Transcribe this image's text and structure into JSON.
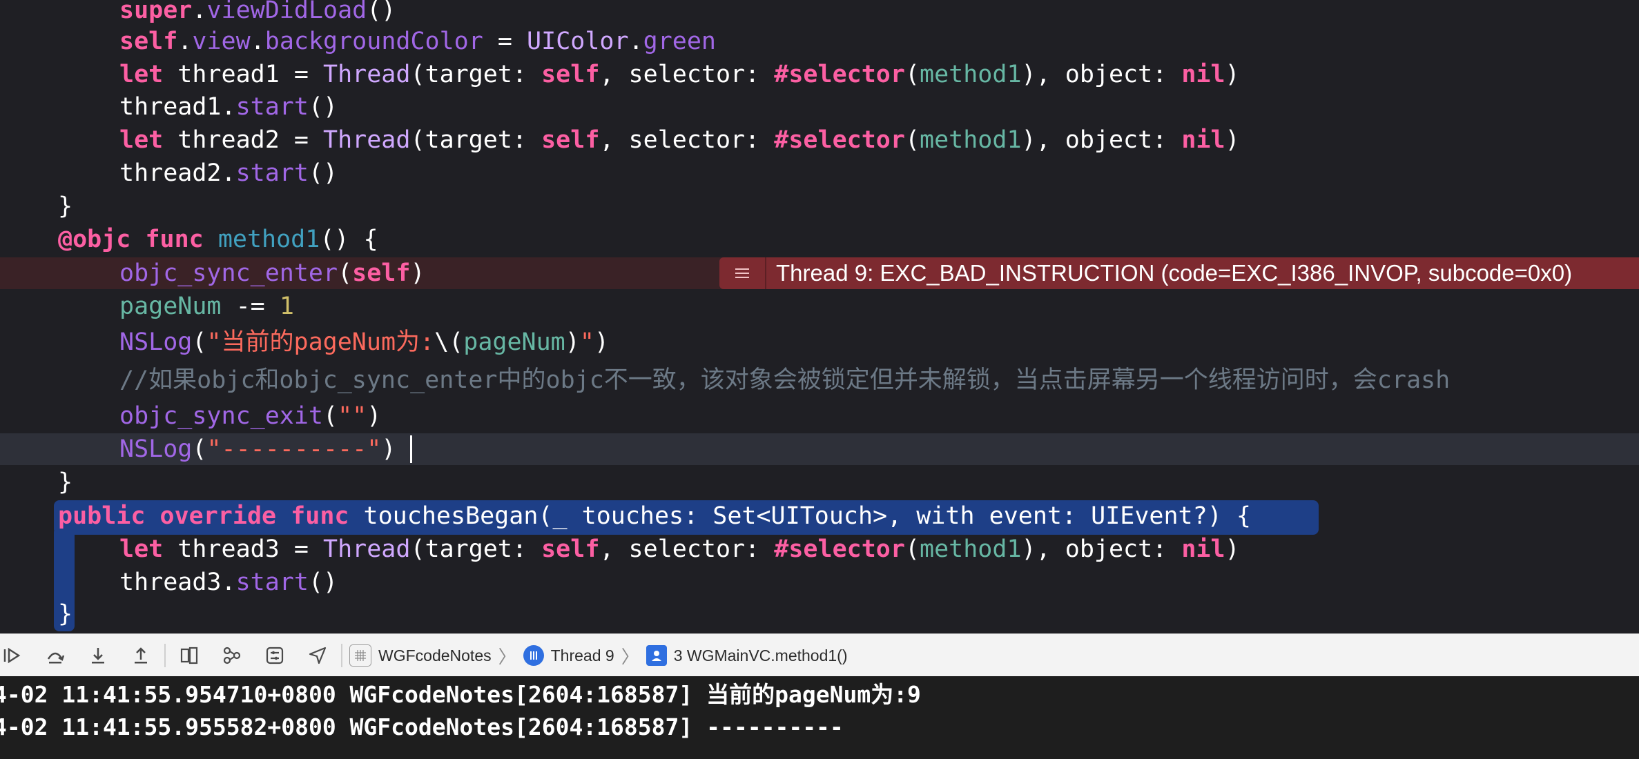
{
  "code": {
    "l1": {
      "a": "super",
      "b": ".",
      "c": "viewDidLoad",
      "d": "()"
    },
    "l2": {
      "a": "self",
      "b": ".",
      "c": "view",
      "d": ".",
      "e": "backgroundColor",
      "f": " = ",
      "g": "UIColor",
      "h": ".",
      "i": "green"
    },
    "l3": {
      "a": "let",
      "b": " thread1 = ",
      "c": "Thread",
      "d": "(target: ",
      "e": "self",
      "f": ", selector: ",
      "g": "#selector",
      "h": "(",
      "i": "method1",
      "j": "), object: ",
      "k": "nil",
      "l": ")"
    },
    "l4": {
      "a": "thread1",
      "b": ".",
      "c": "start",
      "d": "()"
    },
    "l5": {
      "a": "let",
      "b": " thread2 = ",
      "c": "Thread",
      "d": "(target: ",
      "e": "self",
      "f": ", selector: ",
      "g": "#selector",
      "h": "(",
      "i": "method1",
      "j": "), object: ",
      "k": "nil",
      "l": ")"
    },
    "l6": {
      "a": "thread2",
      "b": ".",
      "c": "start",
      "d": "()"
    },
    "l7": {
      "a": "}"
    },
    "l8": {
      "a": "@objc",
      "b": " ",
      "c": "func",
      "d": " ",
      "e": "method1",
      "f": "() {"
    },
    "l9": {
      "a": "objc_sync_enter",
      "b": "(",
      "c": "self",
      "d": ")"
    },
    "l10": {
      "a": "pageNum",
      "b": " -= ",
      "c": "1"
    },
    "l11": {
      "a": "NSLog",
      "b": "(",
      "c": "\"当前的pageNum为:",
      "d": "\\(",
      "e": "pageNum",
      "f": ")",
      "g": "\"",
      "h": ")"
    },
    "l12": {
      "a": "//如果objc和objc_sync_enter中的objc不一致，该对象会被锁定但并未解锁，当点击屏幕另一个线程访问时，会crash"
    },
    "l13": {
      "a": "objc_sync_exit",
      "b": "(",
      "c": "\"\"",
      "d": ")"
    },
    "l14": {
      "a": "NSLog",
      "b": "(",
      "c": "\"----------\"",
      "d": ")"
    },
    "l15": {
      "a": "}"
    },
    "l16": {
      "a": "public",
      "b": " ",
      "c": "override",
      "d": " ",
      "e": "func",
      "f": " touchesBegan(_ touches: Set<UITouch>, with event: UIEvent?) {"
    },
    "l17": {
      "a": "let",
      "b": " thread3 = ",
      "c": "Thread",
      "d": "(target: ",
      "e": "self",
      "f": ", selector: ",
      "g": "#selector",
      "h": "(",
      "i": "method1",
      "j": "), object: ",
      "k": "nil",
      "l": ")"
    },
    "l18": {
      "a": "thread3",
      "b": ".",
      "c": "start",
      "d": "()"
    },
    "l19": {
      "a": "}"
    }
  },
  "error_banner": {
    "icon": "list-lines-icon",
    "message": "Thread 9: EXC_BAD_INSTRUCTION (code=EXC_I386_INVOP, subcode=0x0)"
  },
  "debug_bar": {
    "icons": [
      "continue-icon",
      "step-over-icon",
      "step-into-icon",
      "step-out-icon",
      "view-hierarchy-icon",
      "memory-graph-icon",
      "environment-overrides-icon",
      "location-icon"
    ],
    "breadcrumbs": [
      {
        "icon": "app-icon",
        "label": "WGFcodeNotes"
      },
      {
        "icon": "thread-icon",
        "label": "Thread 9"
      },
      {
        "icon": "frame-icon",
        "label": "3 WGMainVC.method1()"
      }
    ]
  },
  "console": {
    "lines": [
      "4-02 11:41:55.954710+0800 WGFcodeNotes[2604:168587] 当前的pageNum为:9",
      "4-02 11:41:55.955582+0800 WGFcodeNotes[2604:168587] ----------"
    ]
  },
  "colors": {
    "editor_bg": "#1f1f24",
    "keyword": "#fc5fa3",
    "type": "#d0a8ff",
    "string": "#fc6a5d",
    "error_banner": "#7d2a30",
    "selection": "#1e3f87"
  }
}
